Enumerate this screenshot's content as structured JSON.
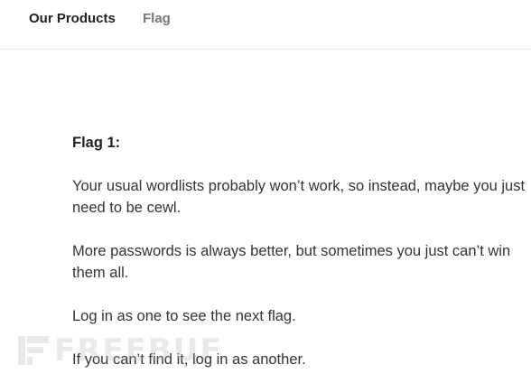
{
  "nav": {
    "items": [
      {
        "label": "Our Products"
      },
      {
        "label": "Flag"
      }
    ]
  },
  "content": {
    "heading": "Flag 1:",
    "paragraphs": [
      "Your usual wordlists probably won’t work, so instead, maybe you just need to be cewl.",
      "More passwords is always better, but sometimes you just can’t win them all.",
      "Log in as one to see the next flag.",
      "If you can’t find it, log in as another."
    ]
  },
  "watermark": {
    "text": "FREEBUF",
    "color": "#b4b4b4"
  }
}
